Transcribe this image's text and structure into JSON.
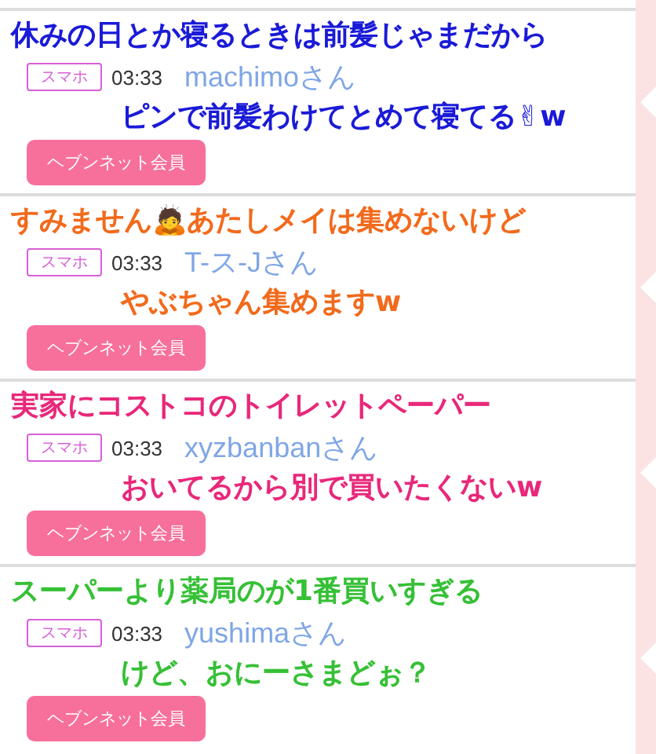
{
  "posts": [
    {
      "device": "スマホ",
      "time": "03:33",
      "name": "machimoさん",
      "member": "ヘブンネット会員",
      "caption": {
        "color": "#1a1ad8",
        "lines": [
          "休みの日とか寝るときは前髪じゃまだから",
          "ピンで前髪わけてとめて寝てる✌w"
        ]
      }
    },
    {
      "device": "スマホ",
      "time": "03:33",
      "name": "T-ス-Jさん",
      "member": "ヘブンネット会員",
      "caption": {
        "color": "#f26a1c",
        "lines": [
          "すみません🙇あたしメイは集めないけど",
          "やぶちゃん集めますw"
        ]
      }
    },
    {
      "device": "スマホ",
      "time": "03:33",
      "name": "xyzbanbanさん",
      "member": "ヘブンネット会員",
      "caption": {
        "color": "#e8287a",
        "lines": [
          "実家にコストコのトイレットペーパー",
          "おいてるから別で買いたくないw"
        ]
      }
    },
    {
      "device": "スマホ",
      "time": "03:33",
      "name": "yushimaさん",
      "member": "ヘブンネット会員",
      "caption": {
        "color": "#36c036",
        "lines": [
          "スーパーより薬局のが1番買いすぎる",
          "けど、おにーさまどぉ？"
        ]
      }
    }
  ]
}
